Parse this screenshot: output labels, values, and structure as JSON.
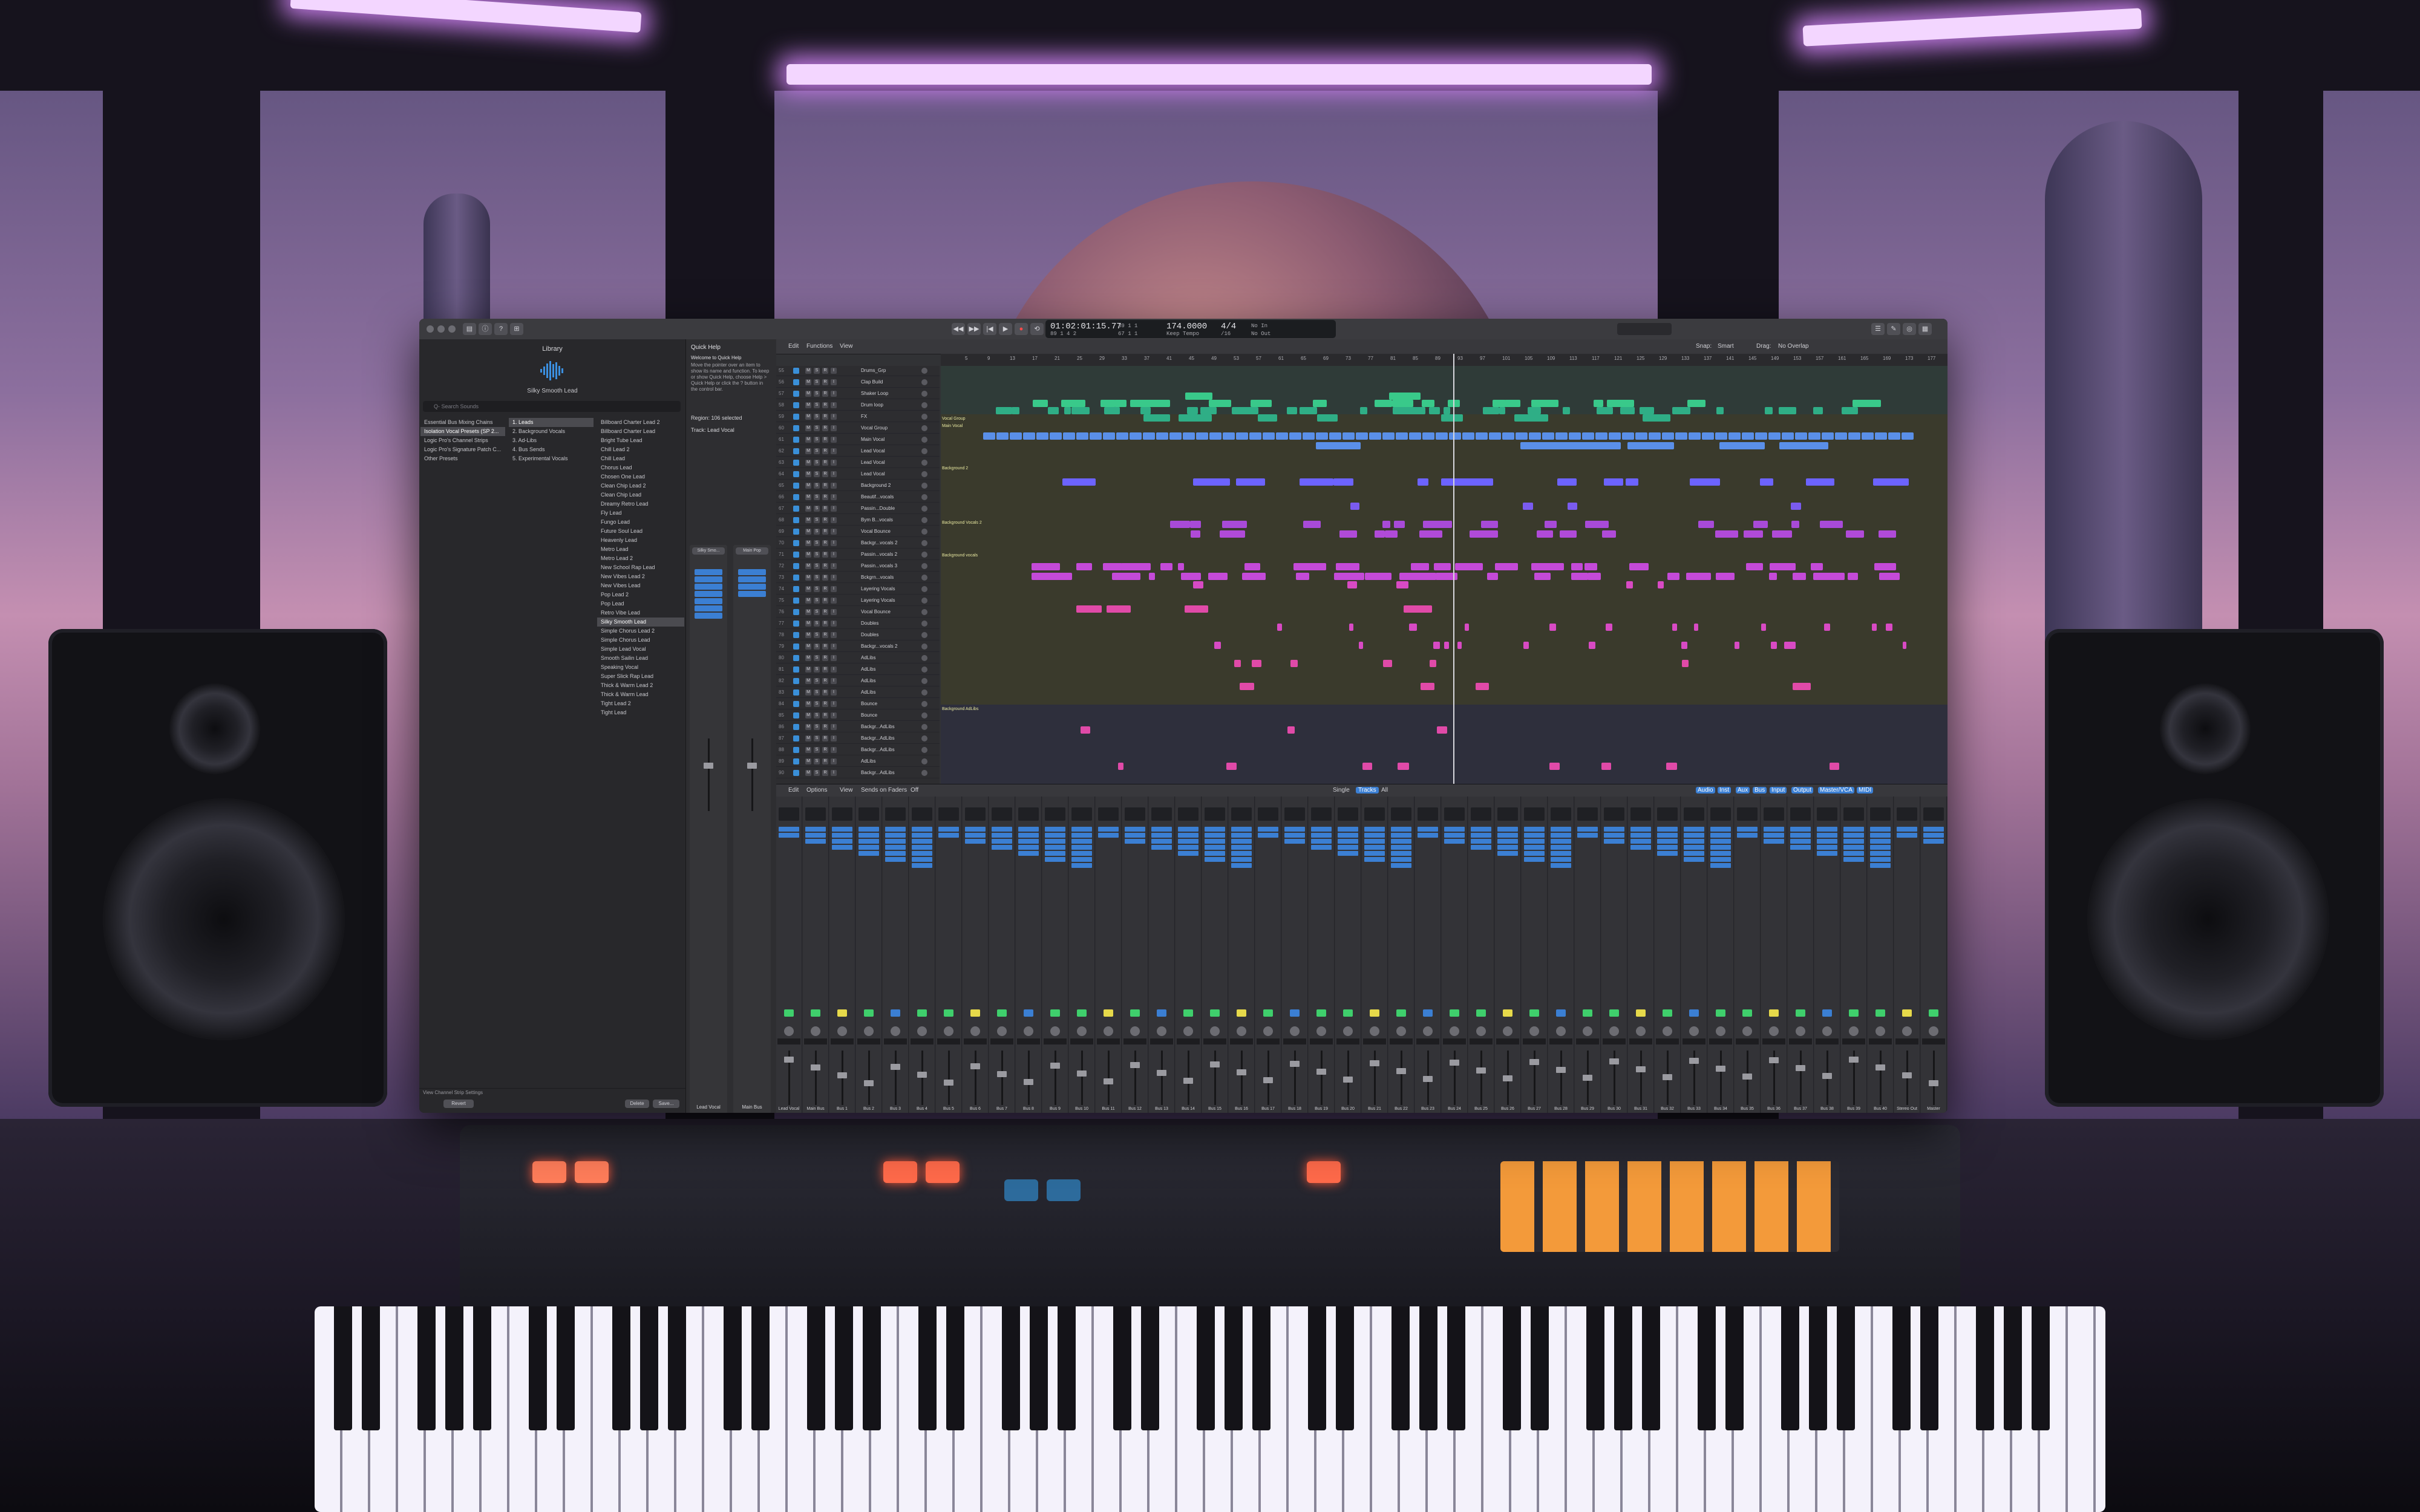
{
  "library": {
    "title": "Library",
    "selected_preset": "Silky Smooth Lead",
    "search_placeholder": "Q- Search Sounds",
    "categories": [
      "Essential Bus Mixing Chains",
      "Isolation Vocal Presets (SP 2...",
      "Logic Pro's Channel Strips",
      "Logic Pro's Signature Patch C...",
      "Other Presets"
    ],
    "subcategories": [
      "1. Leads",
      "2. Background Vocals",
      "3. Ad-Libs",
      "4. Bus Sends",
      "5. Experimental Vocals"
    ],
    "presets": [
      "Billboard Charter Lead 2",
      "Billboard Charter Lead",
      "Bright Tube Lead",
      "Chill Lead 2",
      "Chill Lead",
      "Chorus Lead",
      "Chosen One Lead",
      "Clean Chip Lead 2",
      "Clean Chip Lead",
      "Dreamy Retro Lead",
      "Fly Lead",
      "Fungo Lead",
      "Future Soul Lead",
      "Heavenly Lead",
      "Metro Lead",
      "Metro Lead 2",
      "New School Rap Lead",
      "New Vibes Lead 2",
      "New Vibes Lead",
      "Pop Lead 2",
      "Pop Lead",
      "Retro Vibe Lead",
      "Silky Smooth Lead",
      "Simple Chorus Lead 2",
      "Simple Chorus Lead",
      "Simple Lead Vocal",
      "Smooth Sailin Lead",
      "Speaking Vocal",
      "Super Slick Rap Lead",
      "Thick & Warm Lead 2",
      "Thick & Warm Lead",
      "Tight Lead 2",
      "Tight Lead"
    ],
    "footer_left": "View Channel Strip Settings",
    "revert": "Revert",
    "delete": "Delete",
    "save": "Save..."
  },
  "quick_help": {
    "title": "Quick Help",
    "subtitle": "Welcome to Quick Help",
    "body": "Move the pointer over an item to show its name and function. To keep or show Quick Help, choose Help > Quick Help or click the ? button in the control bar.",
    "region_label": "Region: 106 selected",
    "track_label": "Track: Lead Vocal",
    "strips": [
      {
        "name": "Lead Vocal",
        "top": "Silky Smo..."
      },
      {
        "name": "Main Bus",
        "top": "Main Pop"
      }
    ]
  },
  "transport": {
    "time": "01:02:01:15.77",
    "bars": "89  1  4  2",
    "bars2": "39  1  1",
    "bars3": "67  1  1",
    "tempo": "174.0000",
    "tempo_label": "Keep Tempo",
    "signature": "4/4",
    "division": "/16",
    "in": "No In",
    "out": "No Out"
  },
  "arrange": {
    "menus": [
      "Edit",
      "Functions",
      "View"
    ],
    "snap_label": "Snap:",
    "snap_value": "Smart",
    "drag_label": "Drag:",
    "drag_value": "No Overlap",
    "ruler": [
      "5",
      "9",
      "13",
      "17",
      "21",
      "25",
      "29",
      "33",
      "37",
      "41",
      "45",
      "49",
      "53",
      "57",
      "61",
      "65",
      "69",
      "73",
      "77",
      "81",
      "85",
      "89",
      "93",
      "97",
      "101",
      "105",
      "109",
      "113",
      "117",
      "121",
      "125",
      "129",
      "133",
      "137",
      "141",
      "145",
      "149",
      "153",
      "157",
      "161",
      "165",
      "169",
      "173",
      "177"
    ],
    "tracks": [
      {
        "n": "55",
        "name": "Drums_Grp"
      },
      {
        "n": "56",
        "name": "Clap Build"
      },
      {
        "n": "57",
        "name": "Shaker Loop"
      },
      {
        "n": "58",
        "name": "Drum loop"
      },
      {
        "n": "59",
        "name": "FX"
      },
      {
        "n": "60",
        "name": "Vocal Group"
      },
      {
        "n": "61",
        "name": "Main Vocal"
      },
      {
        "n": "62",
        "name": "Lead Vocal"
      },
      {
        "n": "63",
        "name": "Lead Vocal"
      },
      {
        "n": "64",
        "name": "Lead Vocal"
      },
      {
        "n": "65",
        "name": "Background 2"
      },
      {
        "n": "66",
        "name": "Beautif...vocals"
      },
      {
        "n": "67",
        "name": "Passin...Double"
      },
      {
        "n": "68",
        "name": "Bym B...vocals"
      },
      {
        "n": "69",
        "name": "Vocal Bounce"
      },
      {
        "n": "70",
        "name": "Backgr...vocals 2"
      },
      {
        "n": "71",
        "name": "Passin...vocals 2"
      },
      {
        "n": "72",
        "name": "Passin...vocals 3"
      },
      {
        "n": "73",
        "name": "Bckgrn...vocals"
      },
      {
        "n": "74",
        "name": "Layering Vocals"
      },
      {
        "n": "75",
        "name": "Layering Vocals"
      },
      {
        "n": "76",
        "name": "Vocal Bounce"
      },
      {
        "n": "77",
        "name": "Doubles"
      },
      {
        "n": "78",
        "name": "Doubles"
      },
      {
        "n": "79",
        "name": "Backgr...vocals 2"
      },
      {
        "n": "80",
        "name": "AdLibs"
      },
      {
        "n": "81",
        "name": "AdLibs"
      },
      {
        "n": "82",
        "name": "AdLibs"
      },
      {
        "n": "83",
        "name": "AdLibs"
      },
      {
        "n": "84",
        "name": "Bounce"
      },
      {
        "n": "85",
        "name": "Bounce"
      },
      {
        "n": "86",
        "name": "Backgr...AdLibs"
      },
      {
        "n": "87",
        "name": "Backgr...AdLibs"
      },
      {
        "n": "88",
        "name": "Backgr...AdLibs"
      },
      {
        "n": "89",
        "name": "AdLibs"
      },
      {
        "n": "90",
        "name": "Backgr...AdLibs"
      }
    ],
    "lane_labels": [
      "Vocal Group",
      "Main Vocal",
      "Background 2",
      "Background Vocals 2",
      "Background vocals",
      "Background AdLibs"
    ]
  },
  "mixer": {
    "menus": [
      "Edit",
      "Options",
      "View",
      "Sends on Faders",
      "Off"
    ],
    "modes": [
      "Single",
      "Tracks",
      "All"
    ],
    "filters": [
      "Audio",
      "Inst",
      "Aux",
      "Bus",
      "Input",
      "Output",
      "Master/VCA",
      "MIDI"
    ],
    "channels": [
      "Lead Vocal",
      "Main Bus",
      "Bus 1",
      "Bus 2",
      "Bus 3",
      "Bus 4",
      "Bus 5",
      "Bus 6",
      "Bus 7",
      "Bus 8",
      "Bus 9",
      "Bus 10",
      "Bus 11",
      "Bus 12",
      "Bus 13",
      "Bus 14",
      "Bus 15",
      "Bus 16",
      "Bus 17",
      "Bus 18",
      "Bus 19",
      "Bus 20",
      "Bus 21",
      "Bus 22",
      "Bus 23",
      "Bus 24",
      "Bus 25",
      "Bus 26",
      "Bus 27",
      "Bus 28",
      "Bus 29",
      "Bus 30",
      "Bus 31",
      "Bus 32",
      "Bus 33",
      "Bus 34",
      "Bus 35",
      "Bus 36",
      "Bus 37",
      "Bus 38",
      "Bus 39",
      "Bus 40",
      "Stereo Out",
      "Master"
    ]
  }
}
